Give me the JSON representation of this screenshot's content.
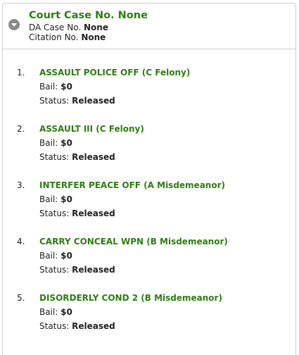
{
  "case": {
    "title": "Court Case No. None",
    "da_label": "DA Case No.",
    "da_value": "None",
    "citation_label": "Citation No.",
    "citation_value": "None"
  },
  "labels": {
    "bail": "Bail:",
    "status": "Status:"
  },
  "charges": [
    {
      "num": "1.",
      "title": "ASSAULT POLICE OFF (C Felony)",
      "bail": "$0",
      "status": "Released"
    },
    {
      "num": "2.",
      "title": "ASSAULT III (C Felony)",
      "bail": "$0",
      "status": "Released"
    },
    {
      "num": "3.",
      "title": "INTERFER PEACE OFF (A Misdemeanor)",
      "bail": "$0",
      "status": "Released"
    },
    {
      "num": "4.",
      "title": "CARRY CONCEAL WPN (B Misdemeanor)",
      "bail": "$0",
      "status": "Released"
    },
    {
      "num": "5.",
      "title": "DISORDERLY COND 2 (B Misdemeanor)",
      "bail": "$0",
      "status": "Released"
    }
  ],
  "colors": {
    "accent": "#2e7d12",
    "border": "#cfcfcf",
    "toggle": "#8a8a8a"
  },
  "icons": {
    "toggle": "chevron-down-icon"
  }
}
